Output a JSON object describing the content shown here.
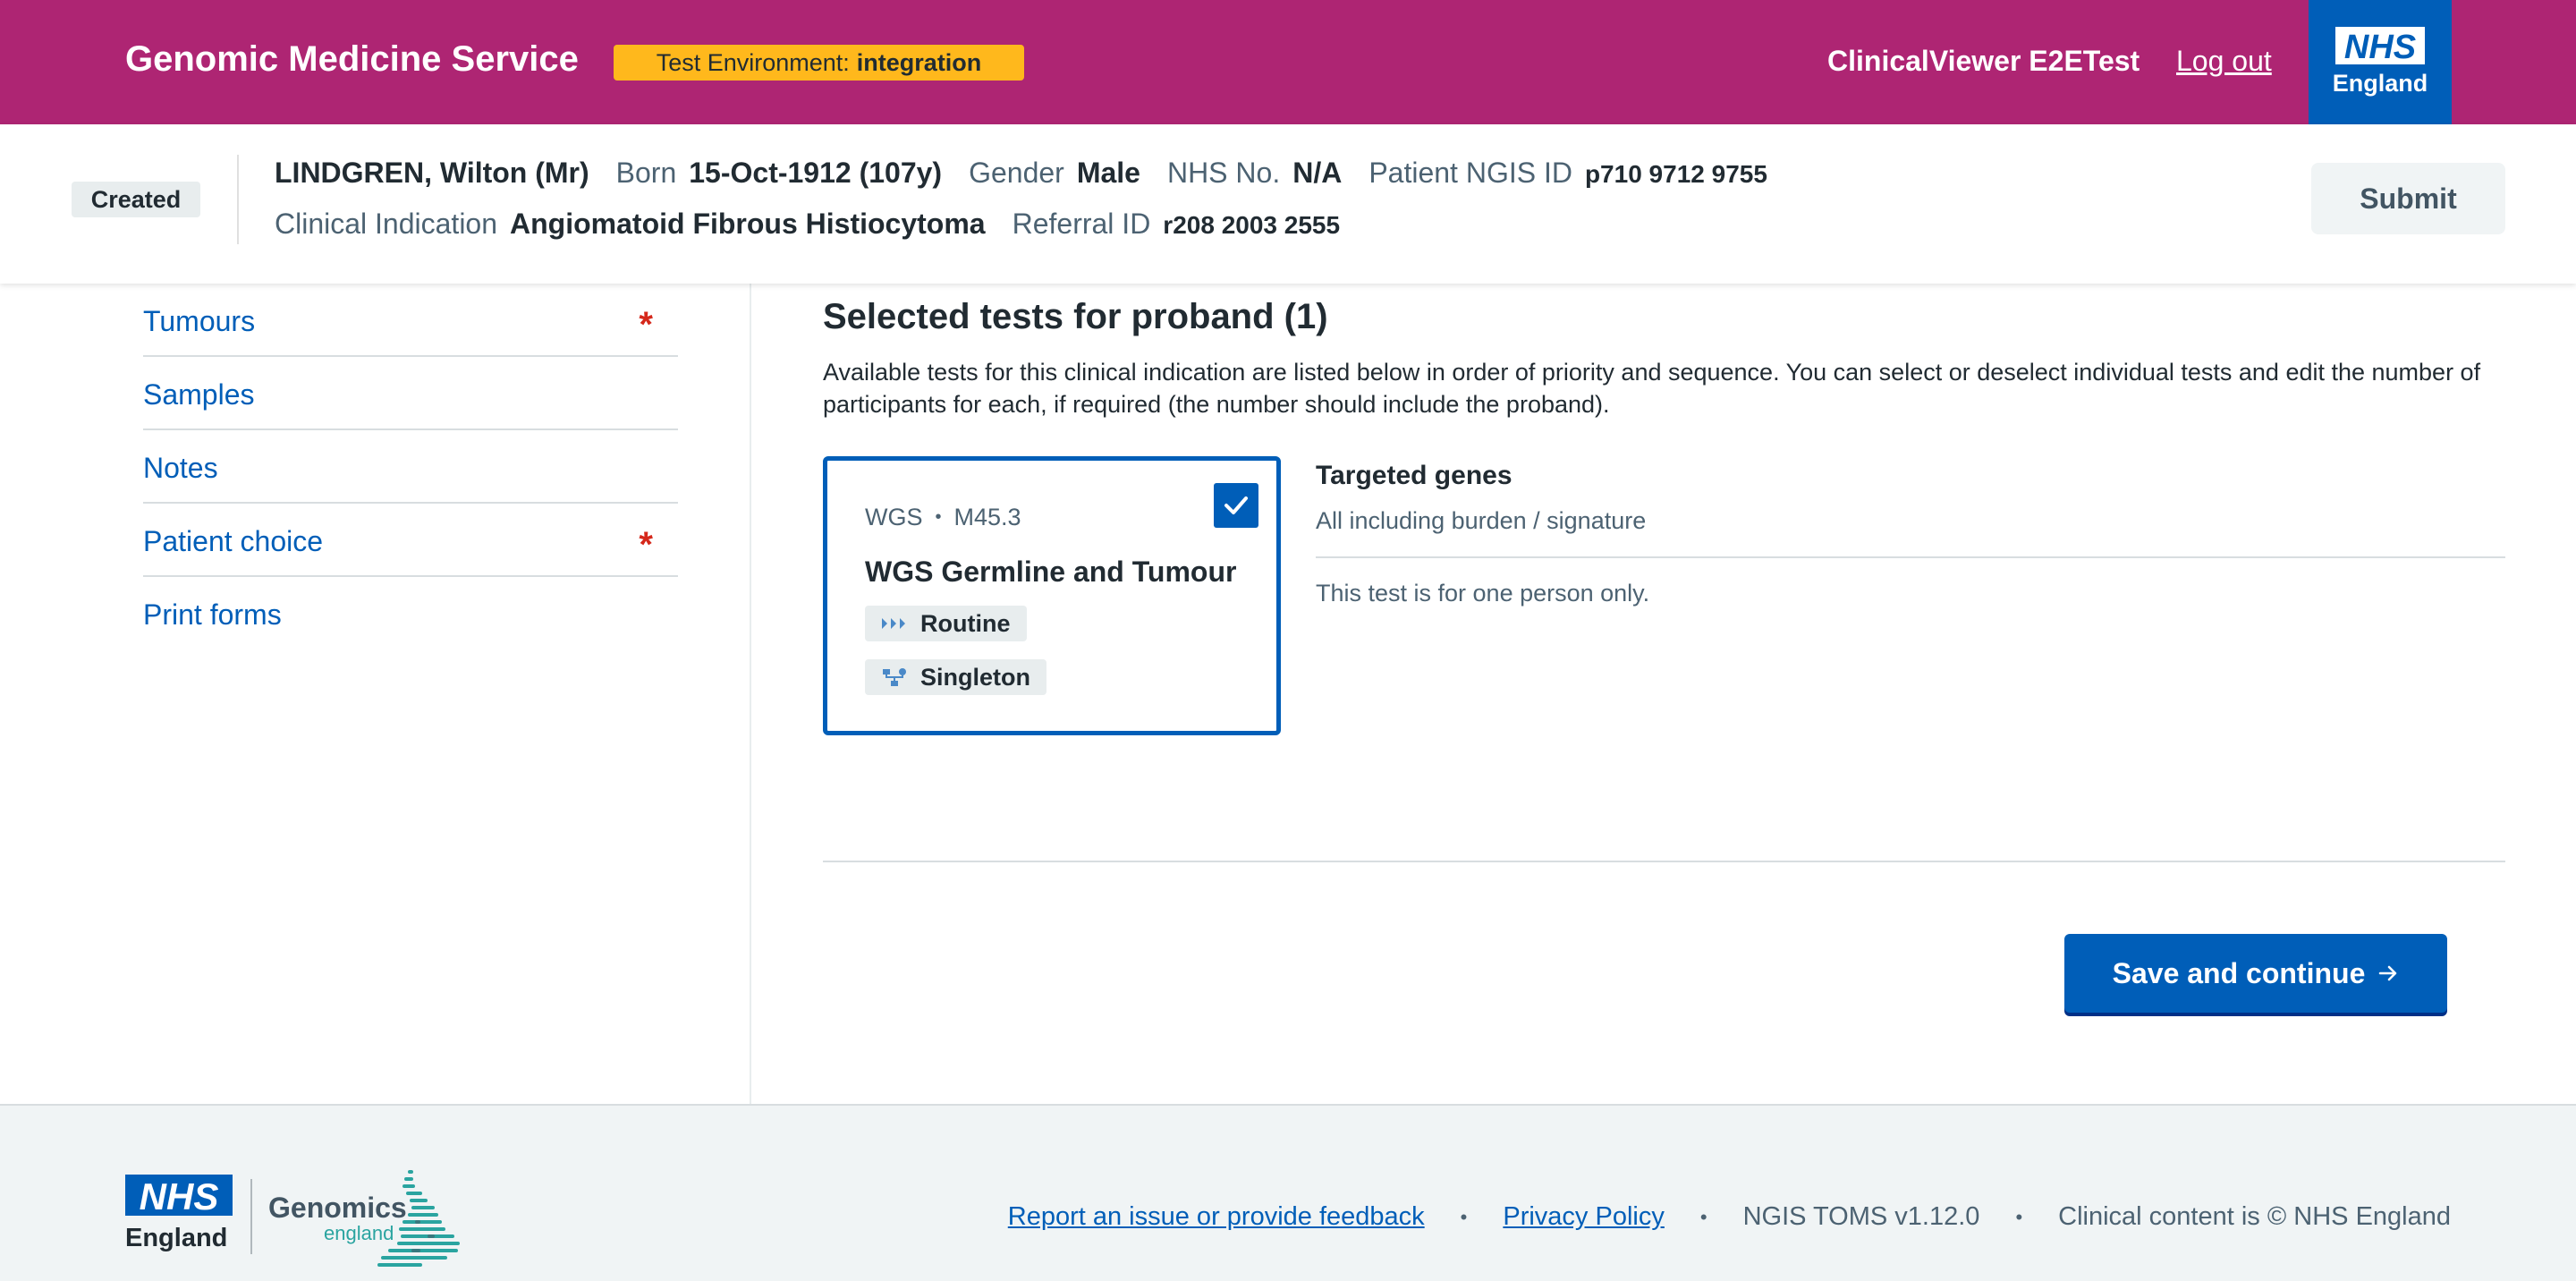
{
  "header": {
    "brand": "Genomic Medicine Service",
    "env_label": "Test Environment:",
    "env_value": "integration",
    "user_name": "ClinicalViewer E2ETest",
    "logout": "Log out",
    "nhs_logo_text": "NHS",
    "nhs_region": "England",
    "brand_color": "#ae2573",
    "nhs_blue": "#005eb8"
  },
  "banner": {
    "status": "Created",
    "patient_name": "LINDGREN, Wilton (Mr)",
    "born_label": "Born",
    "born_value": "15-Oct-1912 (107y)",
    "gender_label": "Gender",
    "gender_value": "Male",
    "nhs_no_label": "NHS No.",
    "nhs_no_value": "N/A",
    "ngis_label": "Patient NGIS ID",
    "ngis_value": "p710 9712 9755",
    "ci_label": "Clinical Indication",
    "ci_value": "Angiomatoid Fibrous Histiocytoma",
    "referral_label": "Referral ID",
    "referral_value": "r208 2003 2555",
    "submit": "Submit"
  },
  "sidebar": {
    "items": [
      {
        "label": "Tumours",
        "required": "*"
      },
      {
        "label": "Samples"
      },
      {
        "label": "Notes"
      },
      {
        "label": "Patient choice",
        "required": "*"
      },
      {
        "label": "Print forms"
      }
    ]
  },
  "main": {
    "title": "Selected tests for proband (1)",
    "description": "Available tests for this clinical indication are listed below in order of priority and sequence. You can select or deselect individual tests and edit the number of participants for each, if required (the number should include the proband).",
    "card": {
      "type": "WGS",
      "sep": "•",
      "code": "M45.3",
      "title": "WGS Germline and Tumour",
      "priority": "Routine",
      "priority_icon": "routine-chevrons-icon",
      "family": "Singleton",
      "family_icon": "singleton-pedigree-icon",
      "checked": true
    },
    "genes_title": "Targeted genes",
    "genes_value": "All including burden / signature",
    "genes_note": "This test is for one person only.",
    "save": "Save and continue",
    "save_icon": "arrow-right-icon"
  },
  "footer": {
    "nhs_logo_text": "NHS",
    "nhs_region": "England",
    "genomics": "Genomics",
    "genomics_sub": "england",
    "links": [
      {
        "label": "Report an issue or provide feedback"
      },
      {
        "label": "Privacy Policy"
      }
    ],
    "bullet": "•",
    "version": "NGIS TOMS v1.12.0",
    "copyright": "Clinical content is © NHS England"
  }
}
